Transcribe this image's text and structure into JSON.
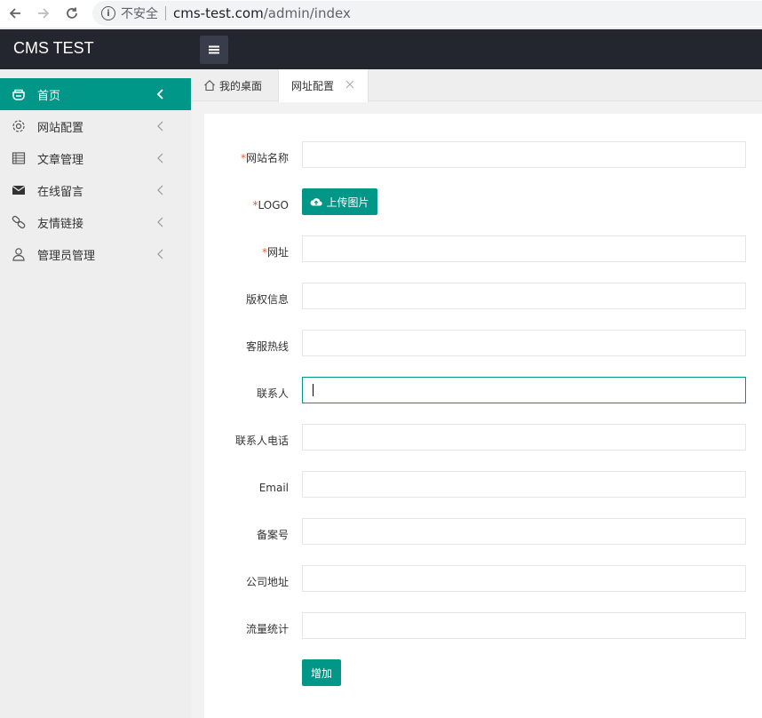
{
  "browser": {
    "security_text": "不安全",
    "url_host": "cms-test.com",
    "url_path": "/admin/index"
  },
  "app": {
    "title": "CMS TEST"
  },
  "sidebar": {
    "items": [
      {
        "label": "首页",
        "icon": "home-icon"
      },
      {
        "label": "网站配置",
        "icon": "gear-icon"
      },
      {
        "label": "文章管理",
        "icon": "table-icon"
      },
      {
        "label": "在线留言",
        "icon": "mail-icon"
      },
      {
        "label": "友情链接",
        "icon": "link-icon"
      },
      {
        "label": "管理员管理",
        "icon": "user-icon"
      }
    ]
  },
  "tabs": {
    "home": "我的桌面",
    "active": "网址配置"
  },
  "form": {
    "site_name": {
      "required": "*",
      "label": "网站名称",
      "value": ""
    },
    "logo": {
      "required": "*",
      "label": "LOGO",
      "button": "上传图片"
    },
    "url": {
      "required": "*",
      "label": "网址",
      "value": ""
    },
    "copyright": {
      "label": "版权信息",
      "value": ""
    },
    "hotline": {
      "label": "客服热线",
      "value": ""
    },
    "contact": {
      "label": "联系人",
      "value": ""
    },
    "contact_phone": {
      "label": "联系人电话",
      "value": ""
    },
    "email": {
      "label": "Email",
      "value": ""
    },
    "icp": {
      "label": "备案号",
      "value": ""
    },
    "address": {
      "label": "公司地址",
      "value": ""
    },
    "stats": {
      "label": "流量统计",
      "value": ""
    },
    "submit": "增加"
  },
  "colors": {
    "accent": "#009688",
    "header": "#23262e",
    "required": "#ff5722"
  }
}
